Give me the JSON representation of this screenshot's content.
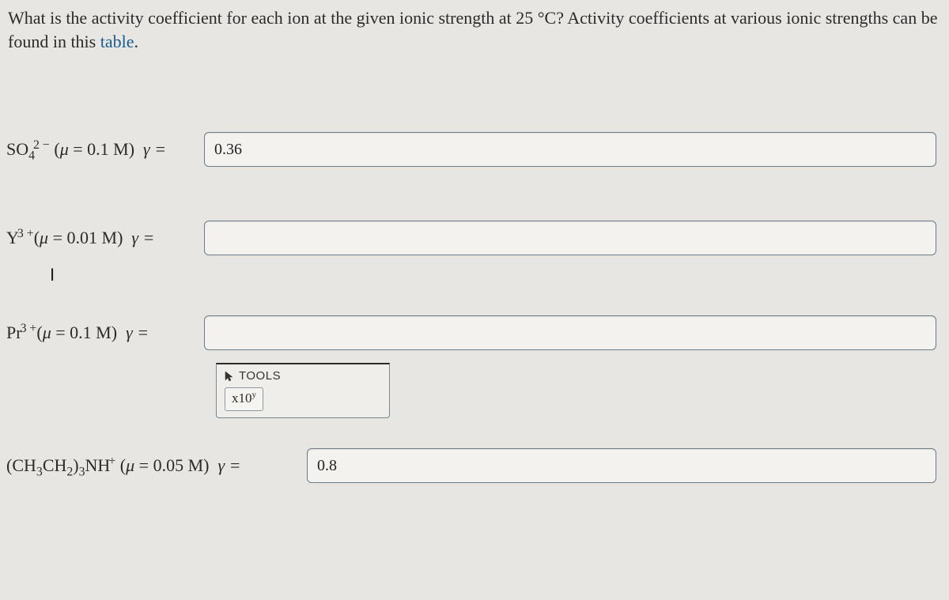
{
  "question": {
    "text_a": "What is the activity coefficient for each ion at the given ionic strength at 25 °C? Activity coefficients at various ionic strengths can be found in this ",
    "link_text": "table",
    "text_b": "."
  },
  "rows": [
    {
      "mu": "0.1 M",
      "value": "0.36"
    },
    {
      "mu": "0.01 M",
      "value": ""
    },
    {
      "mu": "0.1 M",
      "value": ""
    },
    {
      "mu": "0.05 M",
      "value": "0.8"
    }
  ],
  "gamma_eq": "γ =",
  "cursor_placeholder": "I",
  "tools": {
    "title": "TOOLS",
    "btn_prefix": "x10"
  }
}
